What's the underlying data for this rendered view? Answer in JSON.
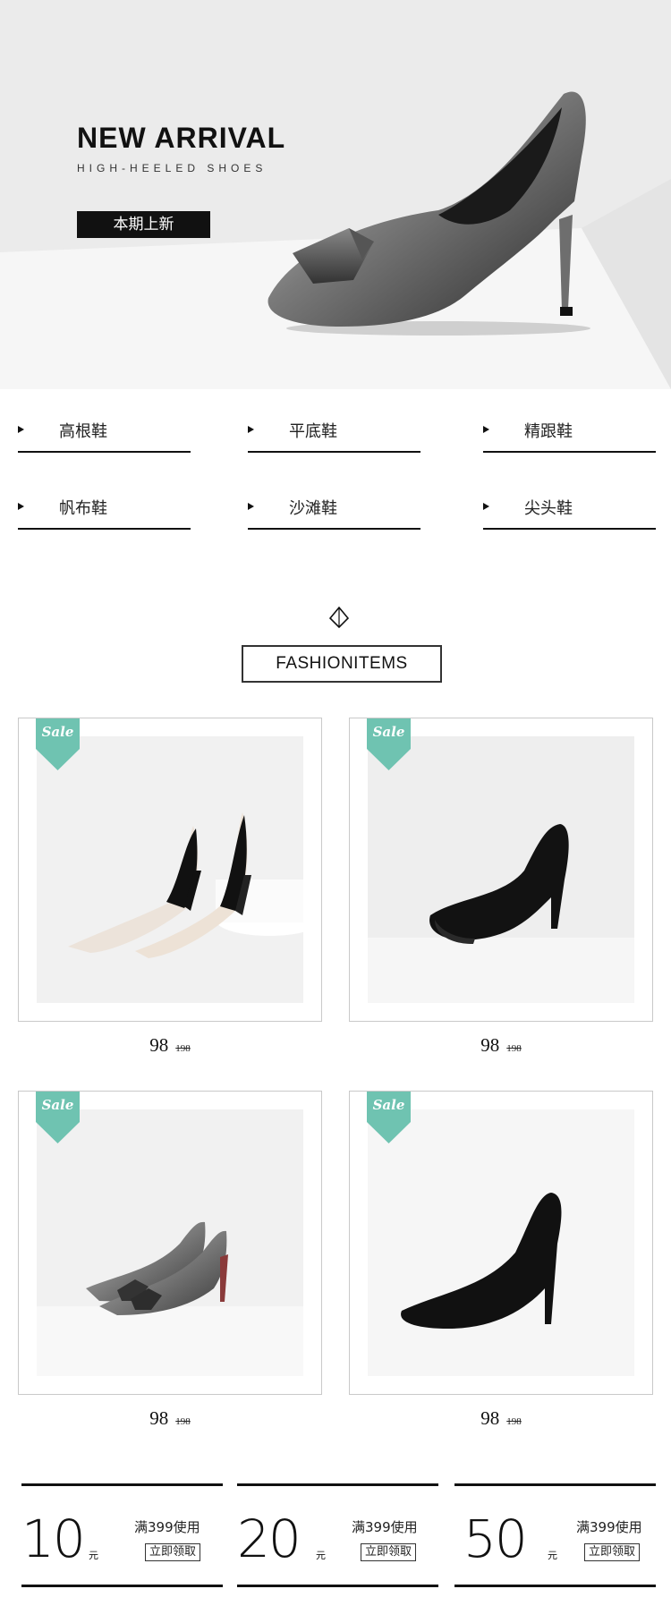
{
  "hero": {
    "title": "NEW ARRIVAL",
    "subtitle": "HIGH-HEELED SHOES",
    "button_label": "本期上新"
  },
  "categories": [
    {
      "label": "高根鞋"
    },
    {
      "label": "平底鞋"
    },
    {
      "label": "精跟鞋"
    },
    {
      "label": "帆布鞋"
    },
    {
      "label": "沙滩鞋"
    },
    {
      "label": "尖头鞋"
    }
  ],
  "section": {
    "icon": "diamond-icon",
    "title": "FASHIONITEMS"
  },
  "products": [
    {
      "tag": "Sale",
      "price": "98",
      "original_price": "198"
    },
    {
      "tag": "Sale",
      "price": "98",
      "original_price": "198"
    },
    {
      "tag": "Sale",
      "price": "98",
      "original_price": "198"
    },
    {
      "tag": "Sale",
      "price": "98",
      "original_price": "198"
    }
  ],
  "coupons": [
    {
      "amount": "10",
      "unit": "元",
      "condition": "满399使用",
      "button": "立即领取"
    },
    {
      "amount": "20",
      "unit": "元",
      "condition": "满399使用",
      "button": "立即领取"
    },
    {
      "amount": "50",
      "unit": "元",
      "condition": "满399使用",
      "button": "立即领取"
    }
  ],
  "colors": {
    "accent": "#111111",
    "sale_tag": "#6fc3b1",
    "border": "#c9c9c9"
  }
}
